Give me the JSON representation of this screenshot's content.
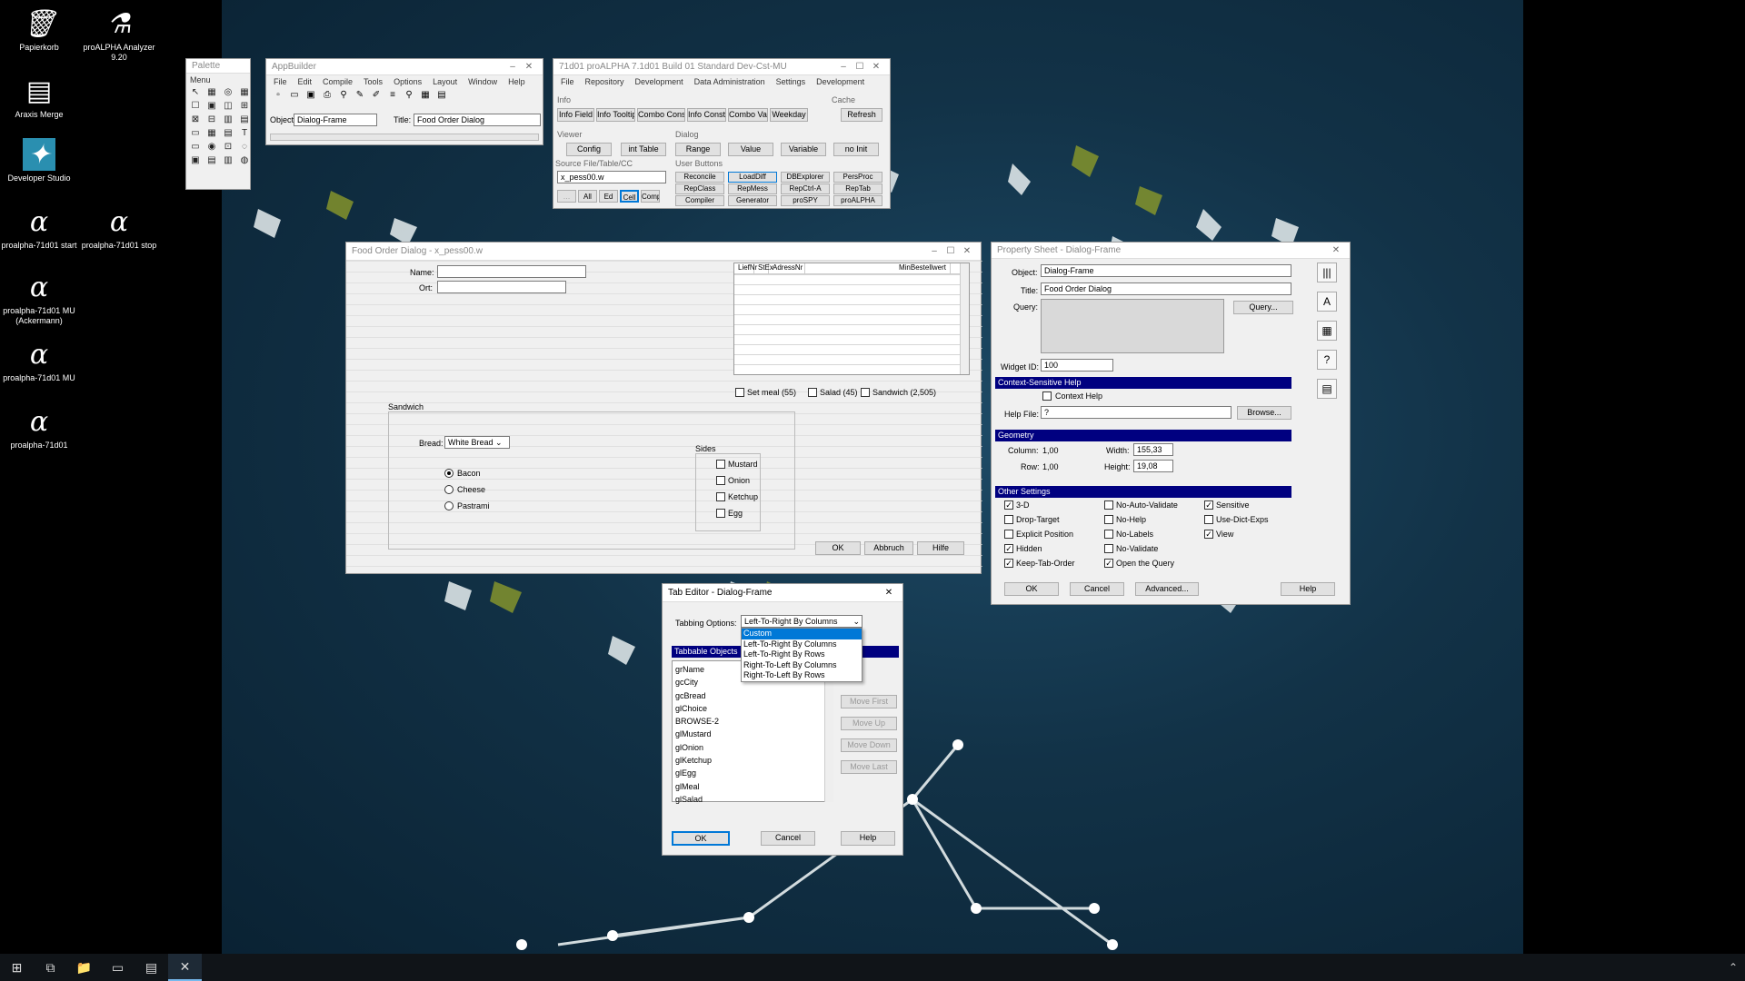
{
  "desktop_icons": [
    {
      "label": "Papierkorb",
      "icon": "recycle-bin-icon",
      "glyph": "🗑"
    },
    {
      "label": "proALPHA Analyzer 9.20",
      "icon": "analyzer-icon",
      "glyph": "⚗"
    },
    {
      "label": "Araxis Merge",
      "icon": "merge-icon",
      "glyph": "▤"
    },
    {
      "label": "Developer Studio",
      "icon": "developer-studio-icon",
      "glyph": "✦"
    },
    {
      "label": "proalpha-71d01 start",
      "icon": "alpha-icon",
      "glyph": "α"
    },
    {
      "label": "proalpha-71d01 stop",
      "icon": "alpha-icon",
      "glyph": "α"
    },
    {
      "label": "proalpha-71d01 MU (Ackermann)",
      "icon": "alpha-icon",
      "glyph": "α"
    },
    {
      "label": "proalpha-71d01 MU",
      "icon": "alpha-icon",
      "glyph": "α"
    },
    {
      "label": "proalpha-71d01",
      "icon": "alpha-icon",
      "glyph": "α"
    }
  ],
  "palette": {
    "title": "Palette",
    "menu": "Menu",
    "tools": [
      "↖",
      "▦",
      "◎",
      "▦",
      "☐",
      "▣",
      "◫",
      "⊞",
      "⊠",
      "⊟",
      "▥",
      "▤",
      "▭",
      "▦",
      "▤",
      "T",
      "▭",
      "◉",
      "⊡",
      "◌",
      "▣",
      "▤",
      "▥",
      "◍"
    ]
  },
  "appbuilder": {
    "title": "AppBuilder",
    "menu": [
      "File",
      "Edit",
      "Compile",
      "Tools",
      "Options",
      "Layout",
      "Window",
      "Help"
    ],
    "toolbar": [
      "▫",
      "▭",
      "▣",
      "⎙",
      "⚲",
      "✎",
      "✐",
      "≡",
      "⚲",
      "▦",
      "▤"
    ],
    "object_label": "Object:",
    "object_value": "Dialog-Frame",
    "title_label": "Title:",
    "title_value": "Food Order Dialog"
  },
  "proalpha": {
    "title": "71d01 proALPHA 7.1d01 Build 01 Standard Dev-Cst-MU",
    "menu": [
      "File",
      "Repository",
      "Development",
      "Data Administration",
      "Settings",
      "Development"
    ],
    "info_label": "Info",
    "cache_label": "Cache",
    "info_buttons": [
      "Info Field",
      "Info Tooltip",
      "Combo Const",
      "Info Const",
      "Combo Var",
      "Weekday"
    ],
    "refresh": "Refresh",
    "viewer_label": "Viewer",
    "dialog_label": "Dialog",
    "viewer_buttons": [
      "Config",
      "int Table"
    ],
    "dialog_buttons": [
      "Range",
      "Value",
      "Variable",
      "no Init"
    ],
    "source_label": "Source File/Table/CC",
    "source_value": "x_pess00.w",
    "user_label": "User Buttons",
    "user_buttons": [
      "Reconcile",
      "LoadDiff",
      "DBExplorer",
      "PersProc",
      "RepClass",
      "RepMess",
      "RepCtrl-A",
      "RepTab",
      "Compiler",
      "Generator",
      "proSPY",
      "proALPHA"
    ],
    "small_buttons": [
      "…",
      "All",
      "Ed",
      "Cell",
      "Comp"
    ]
  },
  "food": {
    "title": "Food Order Dialog - x_pess00.w",
    "name_label": "Name:",
    "ort_label": "Ort:",
    "browse_cols": [
      "LiefNr",
      "StEx",
      "AdressNr",
      "MinBestellwert"
    ],
    "checks": [
      {
        "label": "Set meal (55)",
        "checked": false
      },
      {
        "label": "Salad (45)",
        "checked": false
      },
      {
        "label": "Sandwich (2,505)",
        "checked": false
      }
    ],
    "sandwich_label": "Sandwich",
    "bread_label": "Bread:",
    "bread_value": "White Bread",
    "radios": [
      {
        "label": "Bacon",
        "on": true
      },
      {
        "label": "Cheese",
        "on": false
      },
      {
        "label": "Pastrami",
        "on": false
      }
    ],
    "sides_label": "Sides",
    "sides": [
      "Mustard",
      "Onion",
      "Ketchup",
      "Egg"
    ],
    "ok": "OK",
    "cancel": "Abbruch",
    "help": "Hilfe"
  },
  "property": {
    "title": "Property Sheet - Dialog-Frame",
    "object_label": "Object:",
    "object_value": "Dialog-Frame",
    "title_label": "Title:",
    "title_value": "Food Order Dialog",
    "query_label": "Query:",
    "query_button": "Query...",
    "widget_label": "Widget ID:",
    "widget_value": "100",
    "help_section": "Context-Sensitive Help",
    "context_help": "Context Help",
    "helpfile_label": "Help File:",
    "helpfile_value": "?",
    "browse": "Browse...",
    "geometry_section": "Geometry",
    "column_label": "Column:",
    "column_value": "1,00",
    "width_label": "Width:",
    "width_value": "155,33",
    "row_label": "Row:",
    "row_value": "1,00",
    "height_label": "Height:",
    "height_value": "19,08",
    "other_section": "Other Settings",
    "settings": [
      {
        "label": "3-D",
        "checked": true
      },
      {
        "label": "No-Auto-Validate",
        "checked": false
      },
      {
        "label": "Sensitive",
        "checked": true
      },
      {
        "label": "Drop-Target",
        "checked": false
      },
      {
        "label": "No-Help",
        "checked": false
      },
      {
        "label": "Use-Dict-Exps",
        "checked": false
      },
      {
        "label": "Explicit Position",
        "checked": false
      },
      {
        "label": "No-Labels",
        "checked": false
      },
      {
        "label": "View",
        "checked": true
      },
      {
        "label": "Hidden",
        "checked": true
      },
      {
        "label": "No-Validate",
        "checked": false
      },
      {
        "label": "",
        "checked": false
      },
      {
        "label": "Keep-Tab-Order",
        "checked": true
      },
      {
        "label": "Open the Query",
        "checked": true
      },
      {
        "label": "",
        "checked": false
      }
    ],
    "ok": "OK",
    "cancel": "Cancel",
    "advanced": "Advanced...",
    "help": "Help",
    "side_icons": [
      "|||",
      "A",
      "▦",
      "?",
      "▤"
    ]
  },
  "tabeditor": {
    "title": "Tab Editor - Dialog-Frame",
    "tabbing_label": "Tabbing Options:",
    "tabbing_value": "Left-To-Right By Columns",
    "dropdown": [
      "Custom",
      "Left-To-Right By Columns",
      "Left-To-Right By Rows",
      "Right-To-Left By Columns",
      "Right-To-Left By Rows"
    ],
    "tabbable_label": "Tabbable Objects",
    "objects": [
      "grName",
      "gcCity",
      "gcBread",
      "glChoice",
      "BROWSE-2",
      "glMustard",
      "glOnion",
      "glKetchup",
      "glEgg",
      "glMeal",
      "glSalad"
    ],
    "move_buttons": [
      "Move First",
      "Move Up",
      "Move Down",
      "Move Last"
    ],
    "ok": "OK",
    "cancel": "Cancel",
    "help": "Help"
  },
  "taskbar": [
    {
      "icon": "windows-start-icon",
      "glyph": "⊞"
    },
    {
      "icon": "task-view-icon",
      "glyph": "⧉"
    },
    {
      "icon": "file-explorer-icon",
      "glyph": "📁"
    },
    {
      "icon": "terminal-icon",
      "glyph": "▭"
    },
    {
      "icon": "developer-studio-icon",
      "glyph": "▤"
    },
    {
      "icon": "appbuilder-icon",
      "glyph": "✕"
    }
  ]
}
